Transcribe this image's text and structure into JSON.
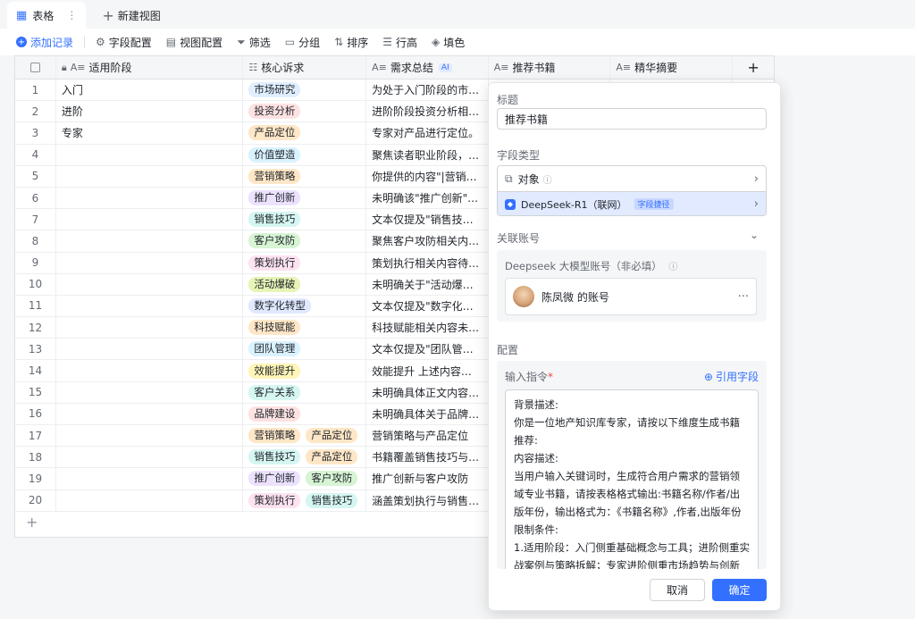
{
  "tabs": {
    "active_label": "表格",
    "more_icon": "⋮",
    "new_view_label": "新建视图"
  },
  "toolbar": {
    "add_record": "添加记录",
    "field_config": "字段配置",
    "view_config": "视图配置",
    "filter": "筛选",
    "group": "分组",
    "sort": "排序",
    "row_height": "行高",
    "fill_color": "填色"
  },
  "table": {
    "headers": {
      "stage": "适用阶段",
      "core_demand": "核心诉求",
      "demand_summary": "需求总结",
      "ai_badge": "AI",
      "book": "推荐书籍",
      "digest": "精华摘要"
    },
    "rows": [
      {
        "num": "1",
        "stage": "入门",
        "tags": [
          "市场研究"
        ],
        "summary": "为处于入门阶段的市场..."
      },
      {
        "num": "2",
        "stage": "进阶",
        "tags": [
          "投资分析"
        ],
        "summary": "进阶阶段投资分析相关..."
      },
      {
        "num": "3",
        "stage": "专家",
        "tags": [
          "产品定位"
        ],
        "summary": "专家对产品进行定位。"
      },
      {
        "num": "4",
        "stage": "",
        "tags": [
          "价值塑造"
        ],
        "summary": "聚焦读者职业阶段，围..."
      },
      {
        "num": "5",
        "stage": "",
        "tags": [
          "营销策略"
        ],
        "summary": "你提供的内容\"|营销策略..."
      },
      {
        "num": "6",
        "stage": "",
        "tags": [
          "推广创新"
        ],
        "summary": "未明确该\"推广创新\"在文..."
      },
      {
        "num": "7",
        "stage": "",
        "tags": [
          "销售技巧"
        ],
        "summary": "文本仅提及\"销售技巧\"，..."
      },
      {
        "num": "8",
        "stage": "",
        "tags": [
          "客户攻防"
        ],
        "summary": "聚焦客户攻防相关内容..."
      },
      {
        "num": "9",
        "stage": "",
        "tags": [
          "策划执行"
        ],
        "summary": "策划执行相关内容待你..."
      },
      {
        "num": "10",
        "stage": "",
        "tags": [
          "活动爆破"
        ],
        "summary": "未明确关于\"活动爆破\"的..."
      },
      {
        "num": "11",
        "stage": "",
        "tags": [
          "数字化转型"
        ],
        "summary": "文本仅提及\"数字化转型\"..."
      },
      {
        "num": "12",
        "stage": "",
        "tags": [
          "科技赋能"
        ],
        "summary": "科技赋能相关内容未展..."
      },
      {
        "num": "13",
        "stage": "",
        "tags": [
          "团队管理"
        ],
        "summary": "文本仅提及\"团队管理\"，..."
      },
      {
        "num": "14",
        "stage": "",
        "tags": [
          "效能提升"
        ],
        "summary": "效能提升 上述内容即为..."
      },
      {
        "num": "15",
        "stage": "",
        "tags": [
          "客户关系"
        ],
        "summary": "未明确具体正文内容，..."
      },
      {
        "num": "16",
        "stage": "",
        "tags": [
          "品牌建设"
        ],
        "summary": "未明确具体关于品牌建..."
      },
      {
        "num": "17",
        "stage": "",
        "tags": [
          "营销策略",
          "产品定位"
        ],
        "summary": "营销策略与产品定位"
      },
      {
        "num": "18",
        "stage": "",
        "tags": [
          "销售技巧",
          "产品定位"
        ],
        "summary": "书籍覆盖销售技巧与产..."
      },
      {
        "num": "19",
        "stage": "",
        "tags": [
          "推广创新",
          "客户攻防"
        ],
        "summary": "推广创新与客户攻防"
      },
      {
        "num": "20",
        "stage": "",
        "tags": [
          "策划执行",
          "销售技巧"
        ],
        "summary": "涵盖策划执行与销售技..."
      }
    ],
    "tag_colors": {
      "市场研究": {
        "bg": "#e0efff",
        "fg": "#1f2329"
      },
      "投资分析": {
        "bg": "#fde2e2",
        "fg": "#1f2329"
      },
      "产品定位": {
        "bg": "#fee7c7",
        "fg": "#1f2329"
      },
      "价值塑造": {
        "bg": "#d9f2ff",
        "fg": "#1f2329"
      },
      "营销策略": {
        "bg": "#fee7c7",
        "fg": "#1f2329"
      },
      "推广创新": {
        "bg": "#ece2fe",
        "fg": "#1f2329"
      },
      "销售技巧": {
        "bg": "#d5f6f2",
        "fg": "#1f2329"
      },
      "客户攻防": {
        "bg": "#d7f4d3",
        "fg": "#1f2329"
      },
      "策划执行": {
        "bg": "#fde2f0",
        "fg": "#1f2329"
      },
      "活动爆破": {
        "bg": "#e6f4b6",
        "fg": "#1f2329"
      },
      "数字化转型": {
        "bg": "#e0e9ff",
        "fg": "#1f2329"
      },
      "科技赋能": {
        "bg": "#fee7c7",
        "fg": "#1f2329"
      },
      "团队管理": {
        "bg": "#d9f2ff",
        "fg": "#1f2329"
      },
      "效能提升": {
        "bg": "#fff5b8",
        "fg": "#1f2329"
      },
      "客户关系": {
        "bg": "#d5f6f2",
        "fg": "#1f2329"
      },
      "品牌建设": {
        "bg": "#fde2e2",
        "fg": "#1f2329"
      }
    },
    "add_row_icon": "+",
    "add_col_icon": "+"
  },
  "panel": {
    "title_label": "标题",
    "title_value": "推荐书籍",
    "field_type_label": "字段类型",
    "type_object": "对象",
    "type_deepseek": "DeepSeek-R1（联网）",
    "type_capability": "字段捷径",
    "linked_account_label": "关联账号",
    "account_hint": "Deepseek 大模型账号（非必填）",
    "account_name": "陈凤微 的账号",
    "config_label": "配置",
    "instruction_label": "输入指令",
    "required_mark": "*",
    "ref_field": "引用字段",
    "prompt_text": "背景描述:\n你是一位地产知识库专家，请按以下维度生成书籍推荐:\n内容描述:\n当用户输入关键词时，生成符合用户需求的营销领域专业书籍，请按表格格式输出:书籍名称/作者/出版年份，输出格式为：《书籍名称》,作者,出版年份\n限制条件:\n1.适用阶段：入门侧重基础概念与工具；进阶侧重实战案例与策略拆解；专家进阶侧重市场趋势与创新模式",
    "cancel": "取消",
    "confirm": "确定"
  },
  "colors": {
    "accent": "#3370ff"
  }
}
